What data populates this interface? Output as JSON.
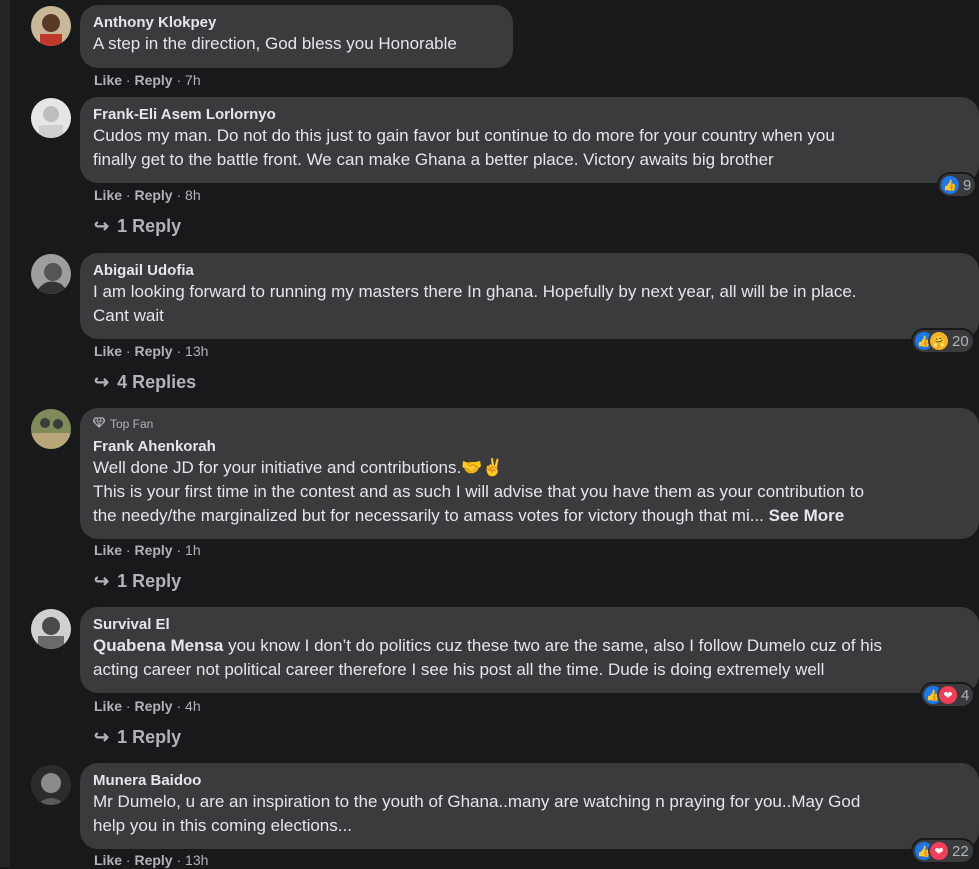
{
  "comments": [
    {
      "author": "Anthony Klokpey",
      "lines": [
        "A step in the direction, God bless you Honorable"
      ],
      "like": "Like",
      "reply": "Reply",
      "time": "7h",
      "replies": "",
      "reactions": ""
    },
    {
      "author": "Frank-Eli Asem Lorlornyo",
      "lines": [
        "Cudos my man. Do not do this just to gain favor but continue to do more for your country when you",
        "finally get to the battle front. We can make Ghana a better place. Victory awaits big brother"
      ],
      "like": "Like",
      "reply": "Reply",
      "time": "8h",
      "replies": "1 Reply",
      "reactions": "9"
    },
    {
      "author": "Abigail Udofia",
      "lines": [
        "I am looking forward to running my masters there In ghana. Hopefully by next year, all will be in place.",
        "Cant wait"
      ],
      "like": "Like",
      "reply": "Reply",
      "time": "13h",
      "replies": "4 Replies",
      "reactions": "20"
    },
    {
      "badge": "Top Fan",
      "author": "Frank Ahenkorah",
      "line1": "Well done JD for your initiative and contributions.🤝✌",
      "line2": "This is your first time in the contest and as such I will advise that you have them as your contribution to",
      "line3": "the needy/the marginalized but for necessarily to amass votes for victory though that mi...",
      "see_more": "See More",
      "like": "Like",
      "reply": "Reply",
      "time": "1h",
      "replies": "1 Reply",
      "reactions": ""
    },
    {
      "author": "Survival El",
      "mention": "Quabena Mensa",
      "line1_rest": " you know I don’t do politics cuz these two are the same, also I follow Dumelo cuz of his",
      "line2": "acting career not political career therefore I see his post all the time. Dude is doing extremely well",
      "like": "Like",
      "reply": "Reply",
      "time": "4h",
      "replies": "1 Reply",
      "reactions": "4"
    },
    {
      "author": "Munera Baidoo",
      "lines": [
        "Mr Dumelo, u are an inspiration to the youth of Ghana..many are watching n praying for you..May God",
        "help you in this coming elections..."
      ],
      "like": "Like",
      "reply": "Reply",
      "time": "13h",
      "replies": "",
      "reactions": "22"
    }
  ],
  "separator": " · ",
  "icons": {
    "reply_arrow": "reply-arrow-icon",
    "like": "like-reaction-icon",
    "love": "love-reaction-icon",
    "care": "care-reaction-icon",
    "top_fan": "diamond-icon"
  },
  "colors": {
    "background": "#18191a",
    "bubble": "#3a3b3c",
    "text": "#e4e6eb",
    "secondary": "#b0b3b8",
    "like_blue": "#1877f2",
    "love_red": "#f33e58"
  }
}
